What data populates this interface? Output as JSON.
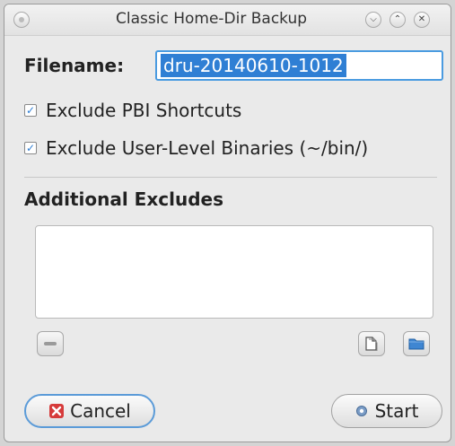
{
  "window": {
    "title": "Classic Home-Dir Backup"
  },
  "filename": {
    "label": "Filename:",
    "value": "dru-20140610-1012"
  },
  "options": [
    {
      "label": "Exclude PBI Shortcuts",
      "checked": true
    },
    {
      "label": "Exclude User-Level Binaries (~/bin/)",
      "checked": true
    }
  ],
  "additional_excludes": {
    "heading": "Additional Excludes",
    "items": []
  },
  "buttons": {
    "cancel": "Cancel",
    "start": "Start"
  },
  "icons": {
    "remove": "minus-icon",
    "add_file": "file-icon",
    "add_folder": "folder-icon",
    "cancel": "cancel-icon",
    "start": "gear-icon"
  },
  "colors": {
    "accent": "#4a9be0",
    "selection": "#2f7fd4",
    "cancel_icon": "#d63b3b"
  }
}
